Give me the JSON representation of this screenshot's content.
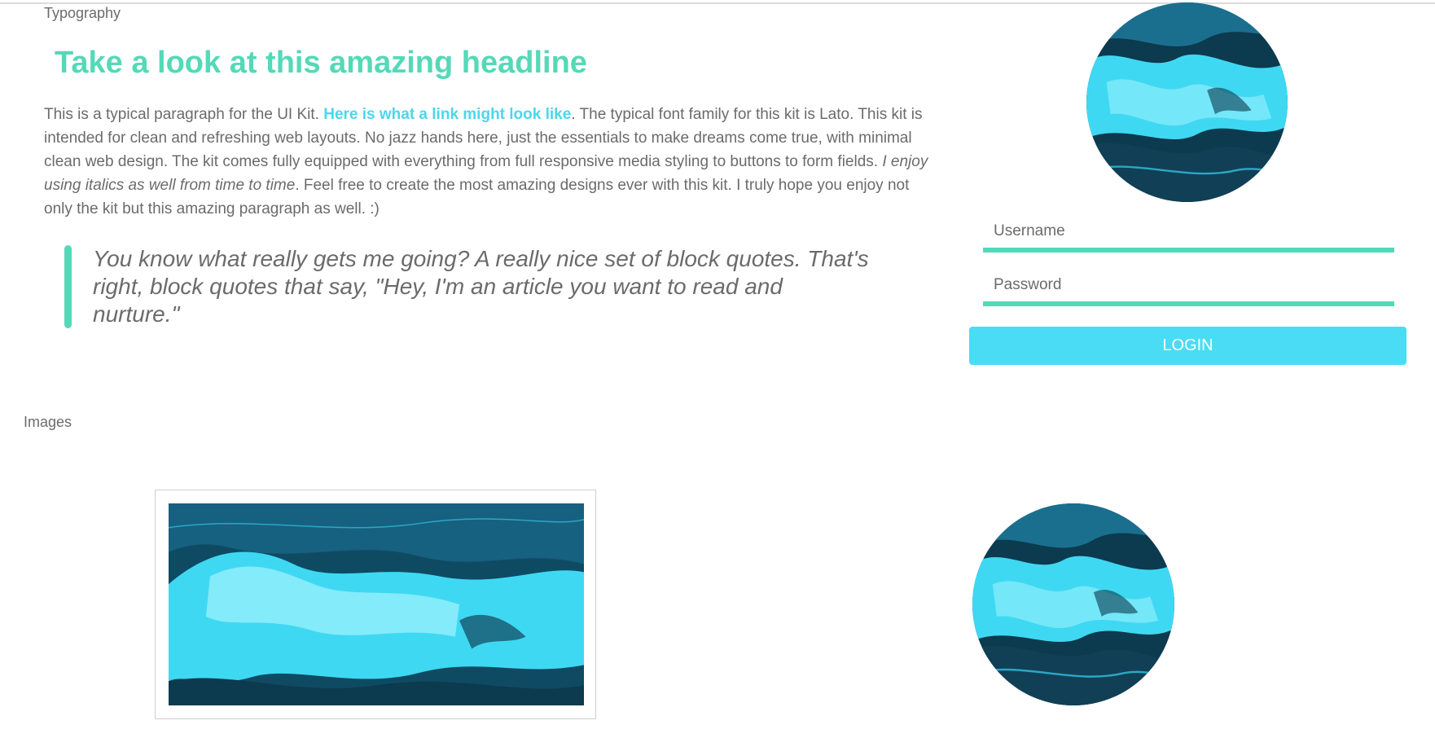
{
  "typography": {
    "section_label": "Typography",
    "headline": "Take a look at this amazing headline",
    "paragraph": {
      "intro": "This is a typical paragraph for the UI Kit. ",
      "link_text": "Here is what a link might look like",
      "middle": ". The typical font family for this kit is Lato. This kit is intended for clean and refreshing web layouts. No jazz hands here, just the essentials to make dreams come true, with minimal clean web design. The kit comes fully equipped with everything from full responsive media styling to buttons to form fields. ",
      "italic": "I enjoy using italics as well from time to time",
      "outro": ". Feel free to create the most amazing designs ever with this kit. I truly hope you enjoy not only the kit but this amazing paragraph as well. :)"
    },
    "blockquote": "You know what really gets me going? A really nice set of block quotes. That's right, block quotes that say, \"Hey, I'm an article you want to read and nurture.\""
  },
  "login": {
    "username_placeholder": "Username",
    "password_placeholder": "Password",
    "button_label": "LOGIN"
  },
  "images": {
    "section_label": "Images"
  },
  "colors": {
    "accent_green": "#54d9b8",
    "accent_cyan": "#4adcf5",
    "text_gray": "#6b6b6b",
    "wave_dark": "#0c3a4e",
    "wave_light": "#3fd8f2"
  }
}
